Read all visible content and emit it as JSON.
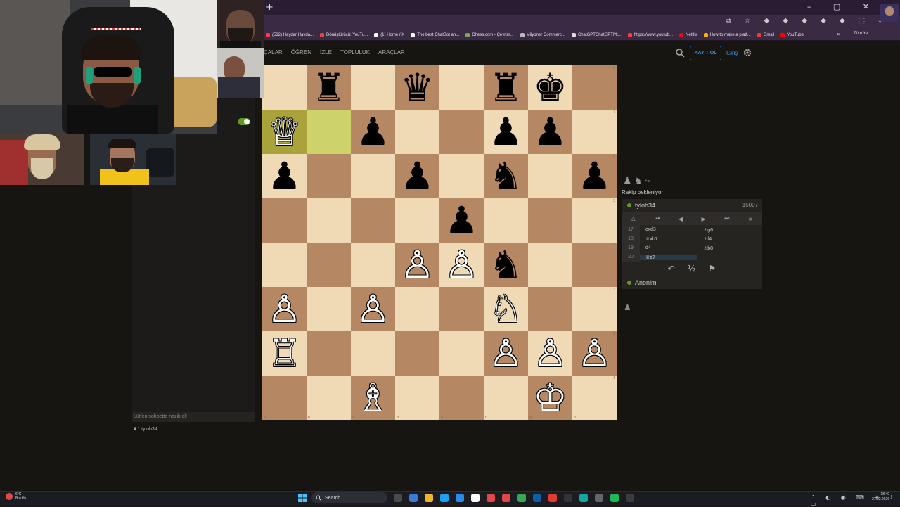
{
  "browser": {
    "new_tab": "+",
    "window_controls": "– ▢ ✕",
    "toolbar_icons": "⧉ ☆ ◆ ◆ ◆ ◆ ◆ ⬚ ⤓",
    "bookmarks": [
      {
        "label": "(532) Haydar Hayda...",
        "color": "#ff3d3d"
      },
      {
        "label": "Dönüştürücü: YouTu...",
        "color": "#e24646"
      },
      {
        "label": "(1) Home / X",
        "color": "#ffffff"
      },
      {
        "label": "The best ChatBot an...",
        "color": "#ffffff"
      },
      {
        "label": "Chess.com - Çevrim...",
        "color": "#7fa650"
      },
      {
        "label": "Milyoner Commerc...",
        "color": "#bbbbbb"
      },
      {
        "label": "ChatGPTChatGPTMt...",
        "color": "#dddddd"
      },
      {
        "label": "https://www.youtub...",
        "color": "#ff3d3d"
      },
      {
        "label": "Netflix",
        "color": "#e50914"
      },
      {
        "label": "How to make a platf...",
        "color": "#ffb000"
      },
      {
        "label": "Gmail",
        "color": "#ea4335"
      },
      {
        "label": "YouTube",
        "color": "#ff0000"
      }
    ],
    "bookmarks_more": "»",
    "all_bookmarks": "Tüm Ye"
  },
  "site": {
    "nav": [
      "ÇALAR",
      "ÖĞREN",
      "İZLE",
      "TOPLULUK",
      "ARAÇLAR"
    ],
    "signup": "KAYIT OL",
    "login": "Giriş",
    "accent": "#3692e7"
  },
  "board": {
    "ranks": [
      "8",
      "7",
      "6",
      "5",
      "4",
      "3",
      "2",
      "1"
    ],
    "files": [
      "a",
      "b",
      "c",
      "d",
      "e",
      "f",
      "g",
      "h"
    ],
    "squares": [
      [
        "",
        "♜",
        "",
        "♛",
        "",
        "♜",
        "♚",
        ""
      ],
      [
        "♕",
        "",
        "♟",
        "",
        "",
        "♟",
        "♟",
        ""
      ],
      [
        "♟",
        "",
        "",
        "♟",
        "",
        "♞",
        "",
        "♟"
      ],
      [
        "",
        "",
        "",
        "",
        "♟",
        "",
        "",
        ""
      ],
      [
        "",
        "",
        "",
        "♙",
        "♙",
        "♞",
        "",
        ""
      ],
      [
        "♙",
        "",
        "♙",
        "",
        "",
        "♘",
        "",
        ""
      ],
      [
        "♖",
        "",
        "",
        "",
        "",
        "♙",
        "♙",
        "♙"
      ],
      [
        "",
        "",
        "♗",
        "",
        "",
        "",
        "♔",
        ""
      ]
    ],
    "colors": [
      [
        "",
        "b",
        "",
        "b",
        "",
        "b",
        "b",
        ""
      ],
      [
        "w",
        "",
        "b",
        "",
        "",
        "b",
        "b",
        ""
      ],
      [
        "b",
        "",
        "",
        "b",
        "",
        "b",
        "",
        "b"
      ],
      [
        "",
        "",
        "",
        "",
        "b",
        "",
        "",
        ""
      ],
      [
        "",
        "",
        "",
        "w",
        "w",
        "b",
        "",
        ""
      ],
      [
        "w",
        "",
        "w",
        "",
        "",
        "w",
        "",
        ""
      ],
      [
        "w",
        "",
        "",
        "",
        "",
        "w",
        "w",
        "w"
      ],
      [
        "",
        "",
        "w",
        "",
        "",
        "",
        "w",
        ""
      ]
    ],
    "highlight": [
      "a7",
      "b7"
    ],
    "light_color": "#f0d9b5",
    "dark_color": "#b58863"
  },
  "game": {
    "material_pieces": [
      "♟",
      "♞"
    ],
    "material_diff": "+5",
    "waiting_text": "Rakip bekleniyor",
    "top_player": "tylob34",
    "top_rating": "15007",
    "moves": [
      {
        "num": "17",
        "white": "cxd3",
        "black": "♗g6"
      },
      {
        "num": "18",
        "white": "♕xb7",
        "black": "♗f4"
      },
      {
        "num": "19",
        "white": "d4",
        "black": "♗b8"
      },
      {
        "num": "20",
        "white": "♕a7",
        "black": ""
      }
    ],
    "nav_icons": [
      "♙",
      "⏮",
      "◀",
      "▶",
      "⏭",
      "≡"
    ],
    "actions": [
      "↶",
      "½",
      "⚑"
    ],
    "bottom_player": "Anonim"
  },
  "chat": {
    "placeholder": "Lütfen sohbette nazik ol!",
    "spectators": "tylob34",
    "spectator_count": "1"
  },
  "taskbar": {
    "weather_temp": "6°C",
    "weather_desc": "Bulutlu",
    "search": "Search",
    "time": "18:49",
    "date": "27.02.2026",
    "tray": "⌃ ◐ ◉ ⌨ ⊕ ♪ ▭",
    "apps": [
      "#4a4a4a",
      "#3b7bd6",
      "#f0b429",
      "#1da1f2",
      "#2a8ae6",
      "#ffffff",
      "#e04848",
      "#e04848",
      "#34a853",
      "#0f5ea8",
      "#e03c31",
      "#333333",
      "#13a89e",
      "#666666",
      "#1db954",
      "#3b3b3b"
    ]
  }
}
